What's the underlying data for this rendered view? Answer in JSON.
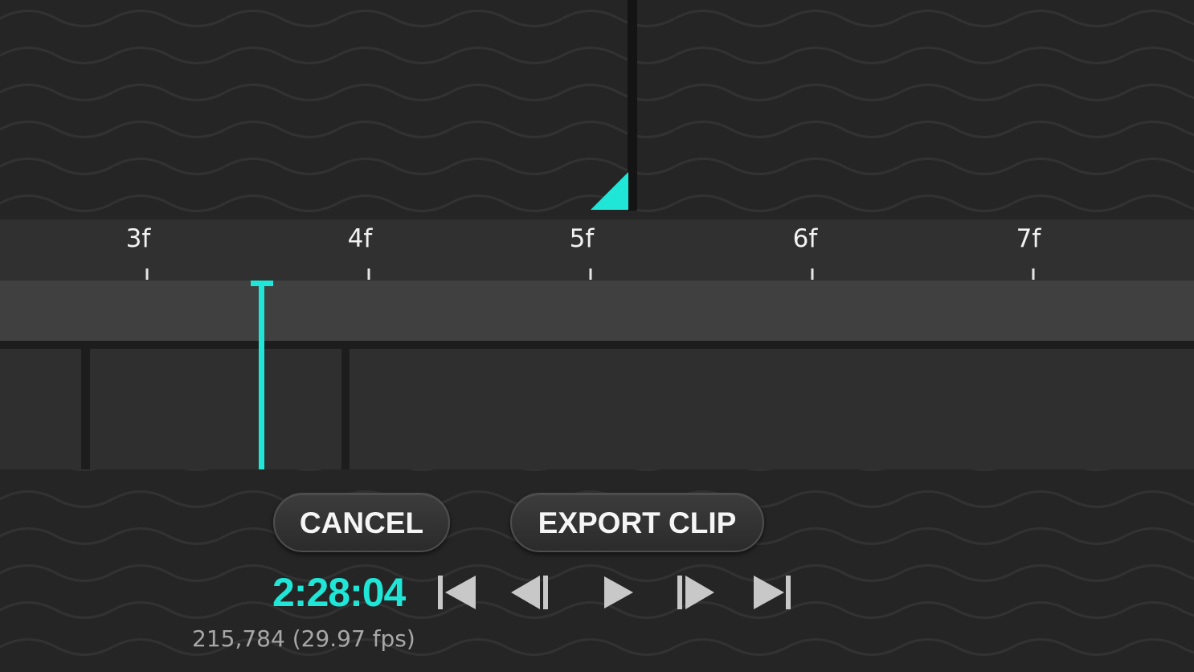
{
  "ruler": {
    "labels": [
      "3f",
      "4f",
      "5f",
      "6f",
      "7f"
    ]
  },
  "buttons": {
    "cancel_label": "CANCEL",
    "export_label": "EXPORT CLIP"
  },
  "playback": {
    "timecode": "2:28:04",
    "frame_info": "215,784 (29.97 fps)"
  },
  "controls": {
    "skip_start_icon": "skip-to-start-icon",
    "step_back_icon": "step-backward-icon",
    "play_icon": "play-icon",
    "step_forward_icon": "step-forward-icon",
    "skip_end_icon": "skip-to-end-icon"
  },
  "colors": {
    "accent": "#1fe6d6",
    "background": "#252525",
    "ruler": "#303030",
    "track": "#404040",
    "segment": "#2f2f2f",
    "button_text": "#f5f5f5",
    "control_icon": "#c8c8c8"
  }
}
